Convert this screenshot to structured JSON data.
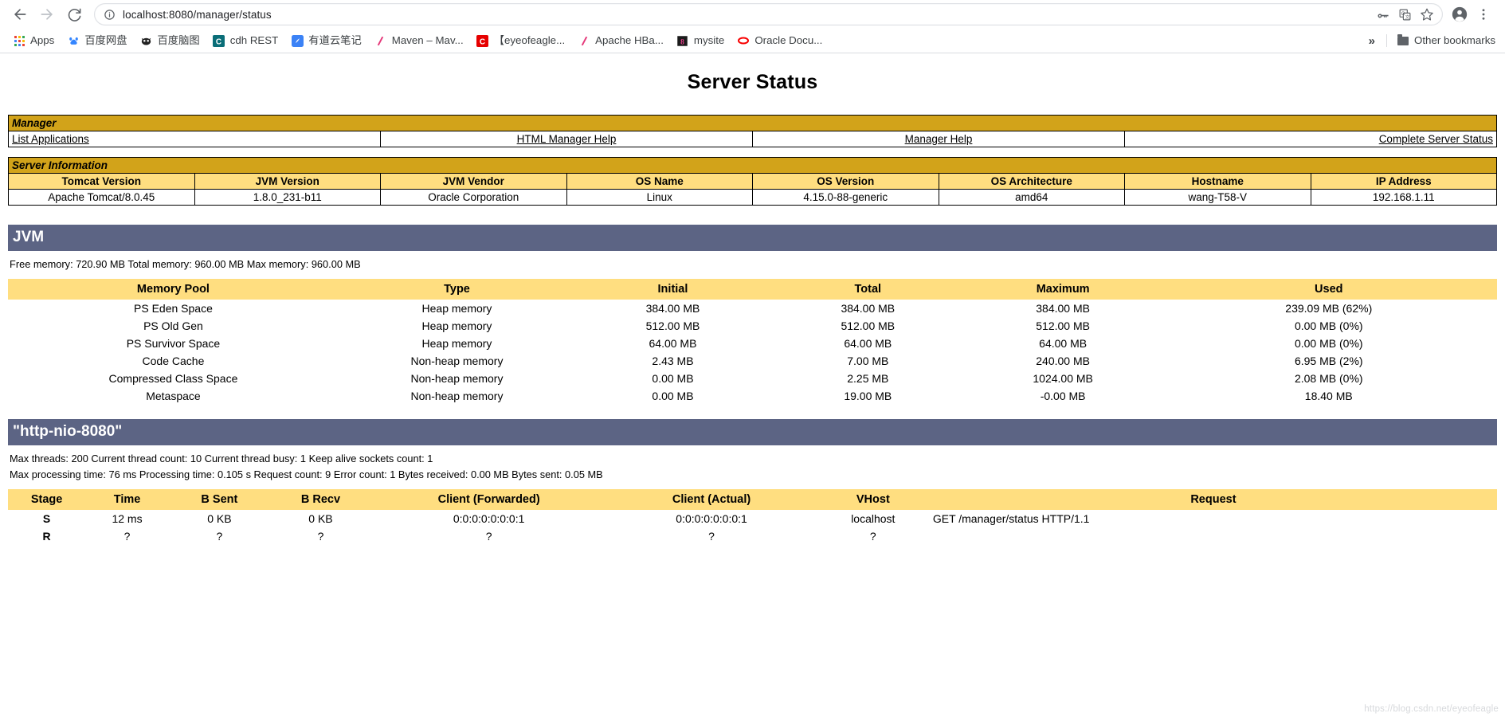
{
  "browser": {
    "back_icon": "back-arrow-icon",
    "forward_icon": "forward-arrow-icon",
    "reload_icon": "reload-icon",
    "info_icon": "info-circle-icon",
    "url": "localhost:8080/manager/status",
    "url_host": "localhost:8080",
    "url_path": "/manager/status",
    "key_icon": "password-key-icon",
    "translate_icon": "translate-icon",
    "bookmark_icon": "star-icon",
    "profile_icon": "profile-avatar-icon",
    "menu_icon": "three-dot-menu-icon"
  },
  "bookmarks": {
    "apps_label": "Apps",
    "items": [
      {
        "label": "百度网盘",
        "icon": "baidu-pan-icon",
        "color": "#3385ff"
      },
      {
        "label": "百度脑图",
        "icon": "baidu-naotu-icon",
        "color": "#222222"
      },
      {
        "label": "cdh REST",
        "icon": "cdh-icon",
        "color": "#0a6e78"
      },
      {
        "label": "有道云笔记",
        "icon": "youdao-note-icon",
        "color": "#3b82f6"
      },
      {
        "label": "Maven – Mav...",
        "icon": "maven-icon",
        "color": "#e5397a"
      },
      {
        "label": "【eyeofeagle...",
        "icon": "csdn-icon",
        "color": "#e60000"
      },
      {
        "label": "Apache HBa...",
        "icon": "hbase-icon",
        "color": "#e5397a"
      },
      {
        "label": "mysite",
        "icon": "mysite-icon",
        "color": "#222222"
      },
      {
        "label": "Oracle Docu...",
        "icon": "oracle-icon",
        "color": "#f80000"
      }
    ],
    "overflow_label": "»",
    "other_bookmarks_label": "Other bookmarks",
    "folder_icon": "folder-icon"
  },
  "page": {
    "title": "Server Status",
    "watermark": "https://blog.csdn.net/eyeofeagle"
  },
  "manager": {
    "section_title": "Manager",
    "links": [
      {
        "label": "List Applications",
        "align": "left"
      },
      {
        "label": "HTML Manager Help",
        "align": "center"
      },
      {
        "label": "Manager Help",
        "align": "center"
      },
      {
        "label": "Complete Server Status",
        "align": "right"
      }
    ]
  },
  "server_information": {
    "section_title": "Server Information",
    "columns": [
      "Tomcat Version",
      "JVM Version",
      "JVM Vendor",
      "OS Name",
      "OS Version",
      "OS Architecture",
      "Hostname",
      "IP Address"
    ],
    "row": [
      "Apache Tomcat/8.0.45",
      "1.8.0_231-b11",
      "Oracle Corporation",
      "Linux",
      "4.15.0-88-generic",
      "amd64",
      "wang-T58-V",
      "192.168.1.11"
    ]
  },
  "jvm": {
    "section_title": "JVM",
    "summary": "Free memory: 720.90 MB Total memory: 960.00 MB Max memory: 960.00 MB",
    "columns": [
      "Memory Pool",
      "Type",
      "Initial",
      "Total",
      "Maximum",
      "Used"
    ],
    "rows": [
      [
        "PS Eden Space",
        "Heap memory",
        "384.00 MB",
        "384.00 MB",
        "384.00 MB",
        "239.09 MB (62%)"
      ],
      [
        "PS Old Gen",
        "Heap memory",
        "512.00 MB",
        "512.00 MB",
        "512.00 MB",
        "0.00 MB (0%)"
      ],
      [
        "PS Survivor Space",
        "Heap memory",
        "64.00 MB",
        "64.00 MB",
        "64.00 MB",
        "0.00 MB (0%)"
      ],
      [
        "Code Cache",
        "Non-heap memory",
        "2.43 MB",
        "7.00 MB",
        "240.00 MB",
        "6.95 MB (2%)"
      ],
      [
        "Compressed Class Space",
        "Non-heap memory",
        "0.00 MB",
        "2.25 MB",
        "1024.00 MB",
        "2.08 MB (0%)"
      ],
      [
        "Metaspace",
        "Non-heap memory",
        "0.00 MB",
        "19.00 MB",
        "-0.00 MB",
        "18.40 MB"
      ]
    ]
  },
  "connector": {
    "section_title": "\"http-nio-8080\"",
    "stats_line1": "Max threads: 200 Current thread count: 10 Current thread busy: 1 Keep alive sockets count: 1",
    "stats_line2": "Max processing time: 76 ms Processing time: 0.105 s Request count: 9 Error count: 1 Bytes received: 0.00 MB Bytes sent: 0.05 MB",
    "columns": [
      "Stage",
      "Time",
      "B Sent",
      "B Recv",
      "Client (Forwarded)",
      "Client (Actual)",
      "VHost",
      "Request"
    ],
    "rows": [
      [
        "S",
        "12 ms",
        "0 KB",
        "0 KB",
        "0:0:0:0:0:0:0:1",
        "0:0:0:0:0:0:0:1",
        "localhost",
        "GET /manager/status HTTP/1.1"
      ],
      [
        "R",
        "?",
        "?",
        "?",
        "?",
        "?",
        "?",
        ""
      ]
    ]
  },
  "colors": {
    "section_gold": "#D2A31A",
    "column_yellow": "#FFDE80",
    "band_slate": "#5C6484"
  }
}
